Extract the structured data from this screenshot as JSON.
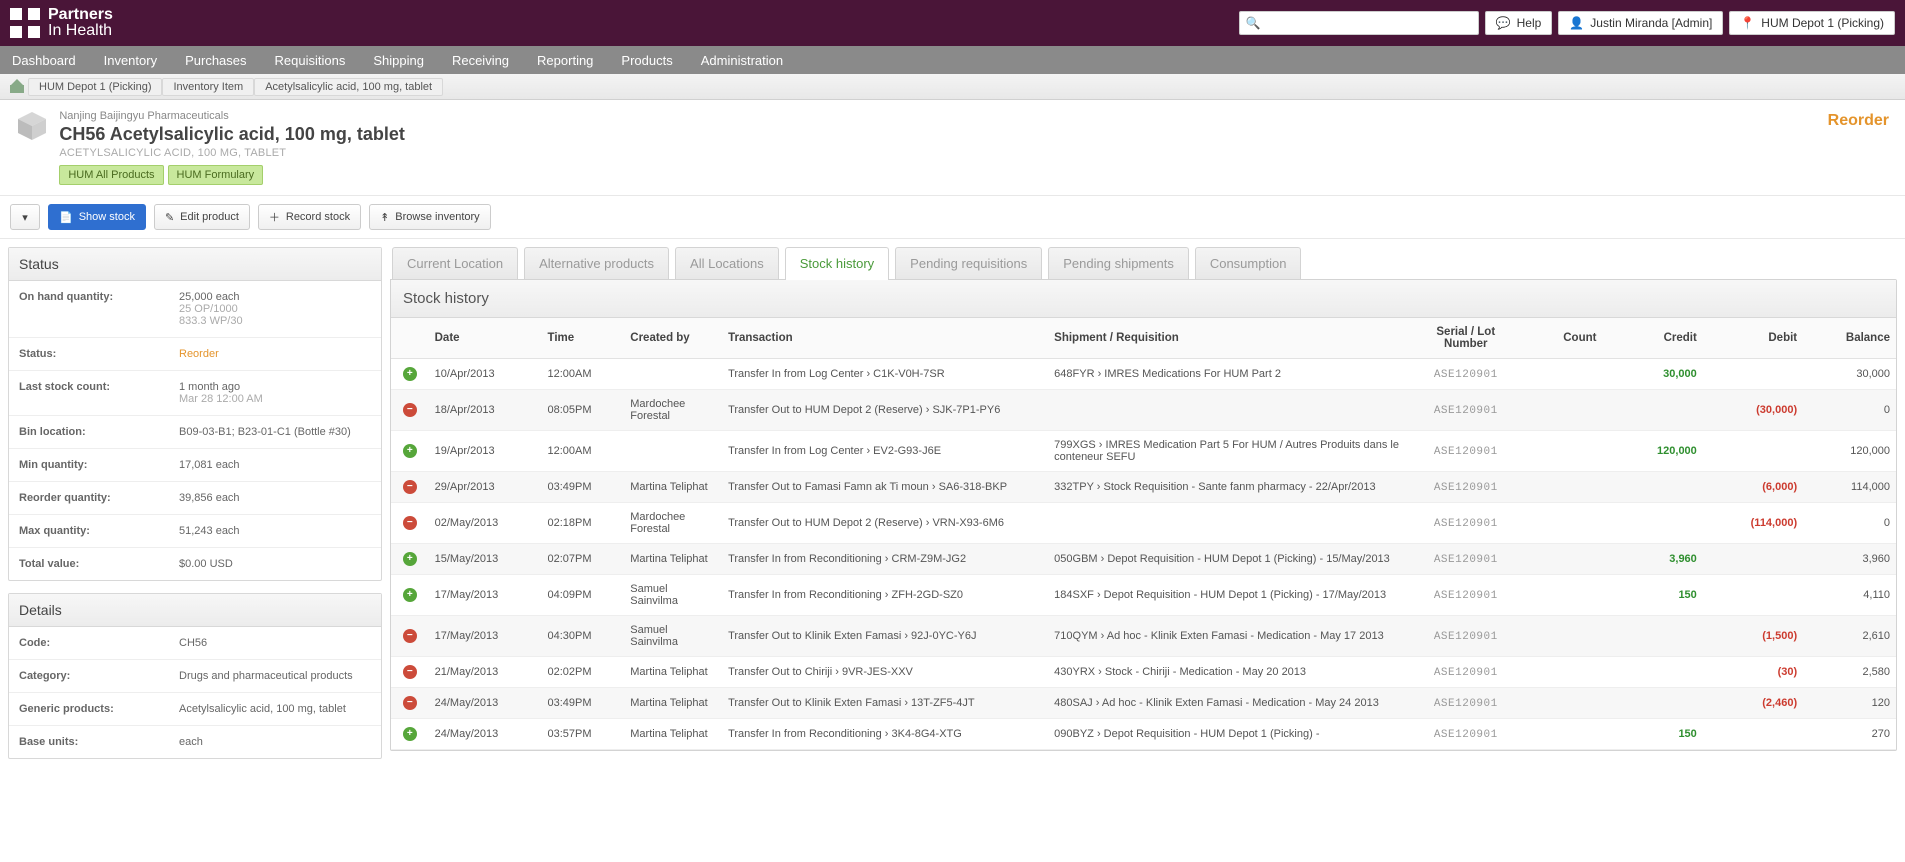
{
  "header": {
    "brand_top": "Partners",
    "brand_bot": "In Health",
    "help": "Help",
    "user": "Justin Miranda [Admin]",
    "location": "HUM Depot 1 (Picking)",
    "search_placeholder": ""
  },
  "nav": {
    "items": [
      "Dashboard",
      "Inventory",
      "Purchases",
      "Requisitions",
      "Shipping",
      "Receiving",
      "Reporting",
      "Products",
      "Administration"
    ]
  },
  "breadcrumb": {
    "items": [
      "HUM Depot 1 (Picking)",
      "Inventory Item",
      "Acetylsalicylic acid, 100 mg, tablet"
    ]
  },
  "product": {
    "manufacturer": "Nanjing Baijingyu Pharmaceuticals",
    "title": "CH56 Acetylsalicylic acid, 100 mg, tablet",
    "generic": "ACETYLSALICYLIC ACID, 100 MG, TABLET",
    "tags": [
      "HUM All Products",
      "HUM Formulary"
    ],
    "reorder": "Reorder"
  },
  "actions": {
    "caret": "▾",
    "show": "Show stock",
    "edit": "Edit product",
    "record": "Record stock",
    "browse": "Browse inventory"
  },
  "status": {
    "title": "Status",
    "on_hand_k": "On hand quantity:",
    "on_hand_v": "25,000 each",
    "on_hand_s1": "25 OP/1000",
    "on_hand_s2": "833.3 WP/30",
    "status_k": "Status:",
    "status_v": "Reorder",
    "last_k": "Last stock count:",
    "last_v": "1 month ago",
    "last_s": "Mar 28 12:00 AM",
    "bin_k": "Bin location:",
    "bin_v": "B09-03-B1; B23-01-C1 (Bottle #30)",
    "min_k": "Min quantity:",
    "min_v": "17,081 each",
    "reorder_k": "Reorder quantity:",
    "reorder_v": "39,856 each",
    "max_k": "Max quantity:",
    "max_v": "51,243 each",
    "total_k": "Total value:",
    "total_v": "$0.00 USD"
  },
  "details": {
    "title": "Details",
    "code_k": "Code:",
    "code_v": "CH56",
    "cat_k": "Category:",
    "cat_v": "Drugs and pharmaceutical products",
    "gen_k": "Generic products:",
    "gen_v": "Acetylsalicylic acid, 100 mg, tablet",
    "base_k": "Base units:",
    "base_v": "each"
  },
  "tabs": {
    "items": [
      "Current Location",
      "Alternative products",
      "All Locations",
      "Stock history",
      "Pending requisitions",
      "Pending shipments",
      "Consumption"
    ],
    "active": 3,
    "panel_title": "Stock history"
  },
  "cols": {
    "date": "Date",
    "time": "Time",
    "user": "Created by",
    "txn": "Transaction",
    "ship": "Shipment / Requisition",
    "lot": "Serial / Lot Number",
    "count": "Count",
    "credit": "Credit",
    "debit": "Debit",
    "bal": "Balance"
  },
  "rows": [
    {
      "dir": "in",
      "date": "10/Apr/2013",
      "time": "12:00AM",
      "user": "",
      "txn": "Transfer In from Log Center › C1K-V0H-7SR",
      "ship": "648FYR › IMRES Medications For HUM Part 2",
      "lot": "ASE120901",
      "count": "",
      "credit": "30,000",
      "debit": "",
      "bal": "30,000"
    },
    {
      "dir": "out",
      "date": "18/Apr/2013",
      "time": "08:05PM",
      "user": "Mardochee Forestal",
      "txn": "Transfer Out to HUM Depot 2 (Reserve) › SJK-7P1-PY6",
      "ship": "",
      "lot": "ASE120901",
      "count": "",
      "credit": "",
      "debit": "(30,000)",
      "bal": "0"
    },
    {
      "dir": "in",
      "date": "19/Apr/2013",
      "time": "12:00AM",
      "user": "",
      "txn": "Transfer In from Log Center › EV2-G93-J6E",
      "ship": "799XGS › IMRES Medication Part 5 For HUM / Autres Produits dans le conteneur SEFU",
      "lot": "ASE120901",
      "count": "",
      "credit": "120,000",
      "debit": "",
      "bal": "120,000"
    },
    {
      "dir": "out",
      "date": "29/Apr/2013",
      "time": "03:49PM",
      "user": "Martina Teliphat",
      "txn": "Transfer Out to Famasi Famn ak Ti moun › SA6-318-BKP",
      "ship": "332TPY › Stock Requisition - Sante fanm pharmacy - 22/Apr/2013",
      "lot": "ASE120901",
      "count": "",
      "credit": "",
      "debit": "(6,000)",
      "bal": "114,000"
    },
    {
      "dir": "out",
      "date": "02/May/2013",
      "time": "02:18PM",
      "user": "Mardochee Forestal",
      "txn": "Transfer Out to HUM Depot 2 (Reserve) › VRN-X93-6M6",
      "ship": "",
      "lot": "ASE120901",
      "count": "",
      "credit": "",
      "debit": "(114,000)",
      "bal": "0"
    },
    {
      "dir": "in",
      "date": "15/May/2013",
      "time": "02:07PM",
      "user": "Martina Teliphat",
      "txn": "Transfer In from Reconditioning › CRM-Z9M-JG2",
      "ship": "050GBM › Depot Requisition - HUM Depot 1 (Picking) - 15/May/2013",
      "lot": "ASE120901",
      "count": "",
      "credit": "3,960",
      "debit": "",
      "bal": "3,960"
    },
    {
      "dir": "in",
      "date": "17/May/2013",
      "time": "04:09PM",
      "user": "Samuel Sainvilma",
      "txn": "Transfer In from Reconditioning › ZFH-2GD-SZ0",
      "ship": "184SXF › Depot Requisition - HUM Depot 1 (Picking) - 17/May/2013",
      "lot": "ASE120901",
      "count": "",
      "credit": "150",
      "debit": "",
      "bal": "4,110"
    },
    {
      "dir": "out",
      "date": "17/May/2013",
      "time": "04:30PM",
      "user": "Samuel Sainvilma",
      "txn": "Transfer Out to Klinik Exten Famasi › 92J-0YC-Y6J",
      "ship": "710QYM › Ad hoc - Klinik Exten Famasi - Medication - May 17 2013",
      "lot": "ASE120901",
      "count": "",
      "credit": "",
      "debit": "(1,500)",
      "bal": "2,610"
    },
    {
      "dir": "out",
      "date": "21/May/2013",
      "time": "02:02PM",
      "user": "Martina Teliphat",
      "txn": "Transfer Out to Chiriji › 9VR-JES-XXV",
      "ship": "430YRX › Stock - Chiriji - Medication - May 20 2013",
      "lot": "ASE120901",
      "count": "",
      "credit": "",
      "debit": "(30)",
      "bal": "2,580"
    },
    {
      "dir": "out",
      "date": "24/May/2013",
      "time": "03:49PM",
      "user": "Martina Teliphat",
      "txn": "Transfer Out to Klinik Exten Famasi › 13T-ZF5-4JT",
      "ship": "480SAJ › Ad hoc - Klinik Exten Famasi - Medication - May 24 2013",
      "lot": "ASE120901",
      "count": "",
      "credit": "",
      "debit": "(2,460)",
      "bal": "120"
    },
    {
      "dir": "in",
      "date": "24/May/2013",
      "time": "03:57PM",
      "user": "Martina Teliphat",
      "txn": "Transfer In from Reconditioning › 3K4-8G4-XTG",
      "ship": "090BYZ › Depot Requisition - HUM Depot 1 (Picking) -",
      "lot": "ASE120901",
      "count": "",
      "credit": "150",
      "debit": "",
      "bal": "270"
    }
  ]
}
